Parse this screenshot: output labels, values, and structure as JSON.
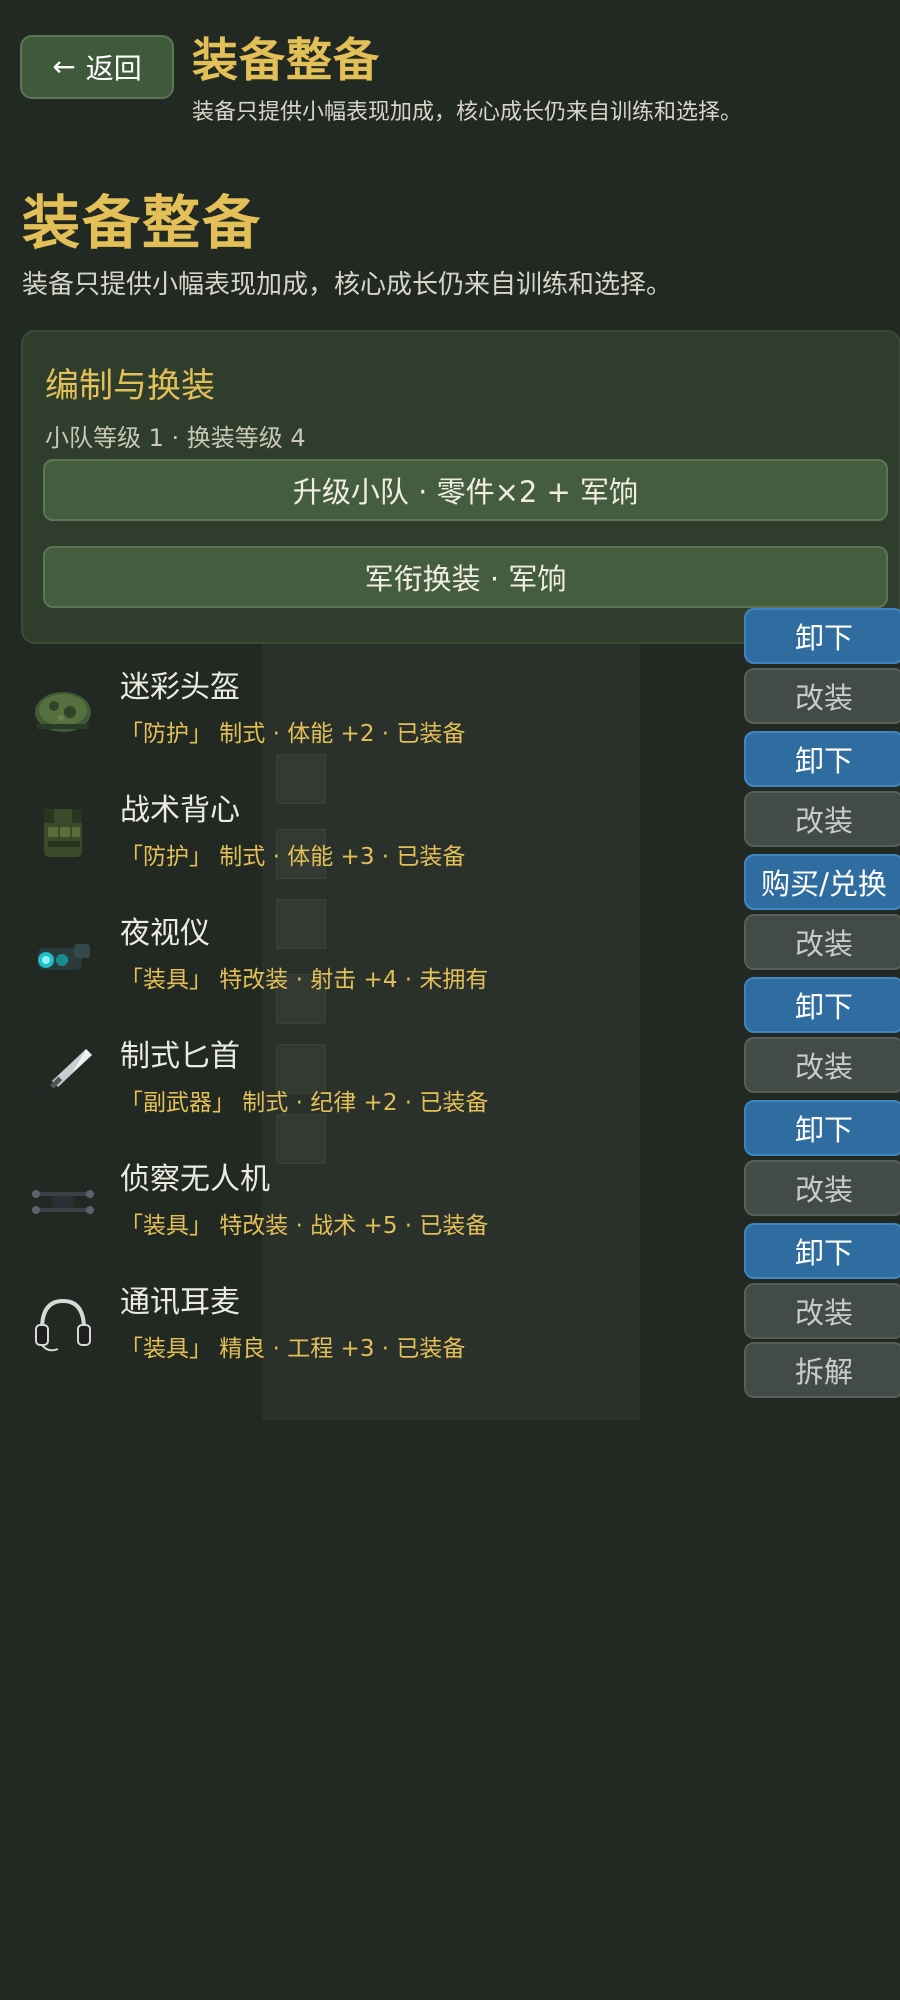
{
  "header": {
    "back_label": "返回",
    "title": "装备整备",
    "subtitle": "装备只提供小幅表现加成，核心成长仍来自训练和选择。"
  },
  "page": {
    "title": "装备整备",
    "subtitle": "装备只提供小幅表现加成，核心成长仍来自训练和选择。"
  },
  "squad_panel": {
    "title": "编制与换装",
    "status": "小队等级 1 · 换装等级 4",
    "upgrade_label": "升级小队 · 零件×2 + 军饷",
    "rank_swap_label": "军衔换装 · 军饷"
  },
  "items": [
    {
      "name": "迷彩头盔",
      "meta": "「防护」 制式 · 体能 +2 · 已装备",
      "icon": "helmet-icon",
      "primary_action": "卸下",
      "secondary_action": "改装"
    },
    {
      "name": "战术背心",
      "meta": "「防护」 制式 · 体能 +3 · 已装备",
      "icon": "vest-icon",
      "primary_action": "卸下",
      "secondary_action": "改装"
    },
    {
      "name": "夜视仪",
      "meta": "「装具」 特改装 · 射击 +4 · 未拥有",
      "icon": "night-vision-icon",
      "primary_action": "购买/兑换",
      "secondary_action": "改装"
    },
    {
      "name": "制式匕首",
      "meta": "「副武器」 制式 · 纪律 +2 · 已装备",
      "icon": "dagger-icon",
      "primary_action": "卸下",
      "secondary_action": "改装"
    },
    {
      "name": "侦察无人机",
      "meta": "「装具」 特改装 · 战术 +5 · 已装备",
      "icon": "drone-icon",
      "primary_action": "卸下",
      "secondary_action": "改装"
    },
    {
      "name": "通讯耳麦",
      "meta": "「装具」 精良 · 工程 +3 · 已装备",
      "icon": "headset-icon",
      "primary_action": "卸下",
      "secondary_action": "改装"
    }
  ],
  "extra_action": "拆解",
  "colors": {
    "background": "#222922",
    "accent_gold": "#e3bf58",
    "primary_button": "#2f6c9f",
    "secondary_button": "#434b46",
    "panel": "#2e3d2c"
  }
}
